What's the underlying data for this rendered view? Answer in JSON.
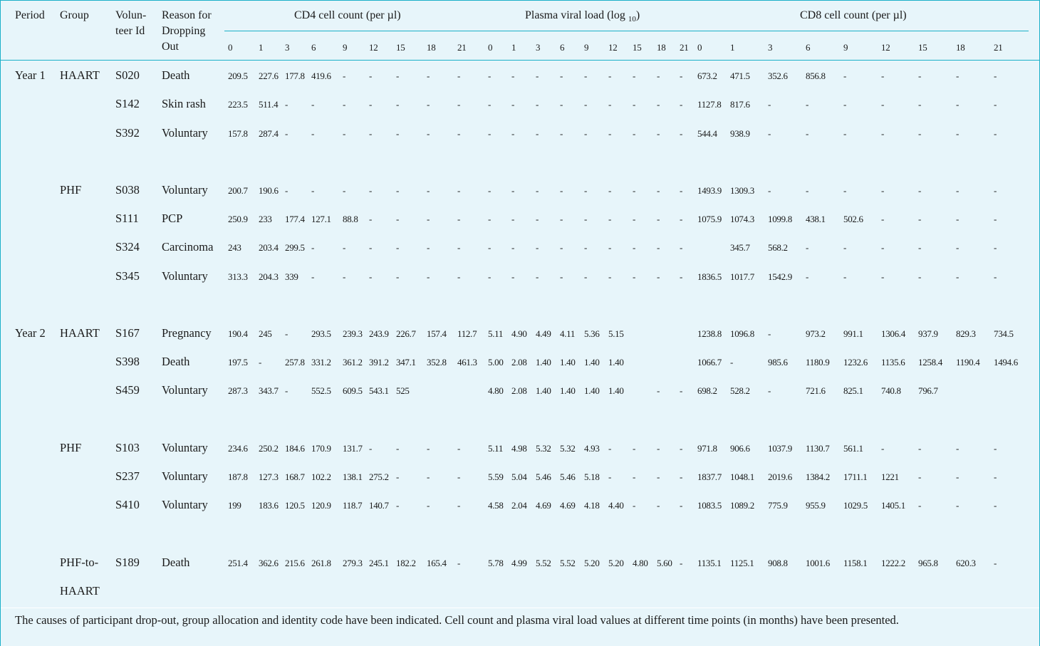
{
  "header": {
    "period": "Period",
    "group": "Group",
    "volunteer_line1": "Volun-",
    "volunteer_line2": "teer Id",
    "reason_line1": "Reason for",
    "reason_line2": "Dropping",
    "reason_line3": "Out",
    "cd4_title": "CD4 cell count (per µl)",
    "viral_title": "Plasma viral load (log",
    "viral_sub": "10",
    "viral_close": ")",
    "cd8_title": "CD8 cell count (per µl)"
  },
  "timepoints": [
    "0",
    "1",
    "3",
    "6",
    "9",
    "12",
    "15",
    "18",
    "21"
  ],
  "rows": [
    {
      "period": "Year 1",
      "group": "HAART",
      "id": "S020",
      "reason": "Death",
      "cd4": [
        "209.5",
        "227.6",
        "177.8",
        "419.6",
        "-",
        "-",
        "-",
        "-",
        "-"
      ],
      "vl": [
        "-",
        "-",
        "-",
        "-",
        "-",
        "-",
        "-",
        "-",
        "-"
      ],
      "cd8": [
        "673.2",
        "471.5",
        "352.6",
        "856.8",
        "-",
        "-",
        "-",
        "-",
        "-"
      ]
    },
    {
      "period": "",
      "group": "",
      "id": "S142",
      "reason": "Skin rash",
      "cd4": [
        "223.5",
        "511.4",
        "-",
        "-",
        "-",
        "-",
        "-",
        "-",
        "-"
      ],
      "vl": [
        "-",
        "-",
        "-",
        "-",
        "-",
        "-",
        "-",
        "-",
        "-"
      ],
      "cd8": [
        "1127.8",
        "817.6",
        "-",
        "-",
        "-",
        "-",
        "-",
        "-",
        "-"
      ]
    },
    {
      "period": "",
      "group": "",
      "id": "S392",
      "reason": "Voluntary",
      "cd4": [
        "157.8",
        "287.4",
        "-",
        "-",
        "-",
        "-",
        "-",
        "-",
        "-"
      ],
      "vl": [
        "-",
        "-",
        "-",
        "-",
        "-",
        "-",
        "-",
        "-",
        "-"
      ],
      "cd8": [
        "544.4",
        "938.9",
        "-",
        "-",
        "-",
        "-",
        "-",
        "-",
        "-"
      ]
    },
    {
      "period": "",
      "group": "PHF",
      "id": "S038",
      "reason": "Voluntary",
      "cd4": [
        "200.7",
        "190.6",
        "-",
        "-",
        "-",
        "-",
        "-",
        "-",
        "-"
      ],
      "vl": [
        "-",
        "-",
        "-",
        "-",
        "-",
        "-",
        "-",
        "-",
        "-"
      ],
      "cd8": [
        "1493.9",
        "1309.3",
        "-",
        "-",
        "-",
        "-",
        "-",
        "-",
        "-"
      ]
    },
    {
      "period": "",
      "group": "",
      "id": "S111",
      "reason": "PCP",
      "cd4": [
        "250.9",
        "233",
        "177.4",
        "127.1",
        "88.8",
        "-",
        "-",
        "-",
        "-"
      ],
      "vl": [
        "-",
        "-",
        "-",
        "-",
        "-",
        "-",
        "-",
        "-",
        "-"
      ],
      "cd8": [
        "1075.9",
        "1074.3",
        "1099.8",
        "438.1",
        "502.6",
        "-",
        "-",
        "-",
        "-"
      ]
    },
    {
      "period": "",
      "group": "",
      "id": "S324",
      "reason": "Carcinoma",
      "cd4": [
        "243",
        "203.4",
        "299.5",
        "-",
        "-",
        "-",
        "-",
        "-",
        "-"
      ],
      "vl": [
        "-",
        "-",
        "-",
        "-",
        "-",
        "-",
        "-",
        "-",
        "-"
      ],
      "cd8": [
        "",
        "345.7",
        "568.2",
        "-",
        "-",
        "-",
        "-",
        "-",
        "-"
      ]
    },
    {
      "period": "",
      "group": "",
      "id": "S345",
      "reason": "Voluntary",
      "cd4": [
        "313.3",
        "204.3",
        "339",
        "-",
        "-",
        "-",
        "-",
        "-",
        "-"
      ],
      "vl": [
        "-",
        "-",
        "-",
        "-",
        "-",
        "-",
        "-",
        "-",
        "-"
      ],
      "cd8": [
        "1836.5",
        "1017.7",
        "1542.9",
        "-",
        "-",
        "-",
        "-",
        "-",
        "-"
      ]
    },
    {
      "period": "Year 2",
      "group": "HAART",
      "id": "S167",
      "reason": "Pregnancy",
      "cd4": [
        "190.4",
        "245",
        "-",
        "293.5",
        "239.3",
        "243.9",
        "226.7",
        "157.4",
        "112.7"
      ],
      "vl": [
        "5.11",
        "4.90",
        "4.49",
        "4.11",
        "5.36",
        "5.15",
        "",
        "",
        ""
      ],
      "cd8": [
        "1238.8",
        "1096.8",
        "-",
        "973.2",
        "991.1",
        "1306.4",
        "937.9",
        "829.3",
        "734.5"
      ]
    },
    {
      "period": "",
      "group": "",
      "id": "S398",
      "reason": "Death",
      "cd4": [
        "197.5",
        "-",
        "257.8",
        "331.2",
        "361.2",
        "391.2",
        "347.1",
        "352.8",
        "461.3"
      ],
      "vl": [
        "5.00",
        "2.08",
        "1.40",
        "1.40",
        "1.40",
        "1.40",
        "",
        "",
        ""
      ],
      "cd8": [
        "1066.7",
        "-",
        "985.6",
        "1180.9",
        "1232.6",
        "1135.6",
        "1258.4",
        "1190.4",
        "1494.6"
      ]
    },
    {
      "period": "",
      "group": "",
      "id": "S459",
      "reason": "Voluntary",
      "cd4": [
        "287.3",
        "343.7",
        "-",
        "552.5",
        "609.5",
        "543.1",
        "525",
        "",
        ""
      ],
      "vl": [
        "4.80",
        "2.08",
        "1.40",
        "1.40",
        "1.40",
        "1.40",
        "",
        "-",
        "-"
      ],
      "cd8": [
        "698.2",
        "528.2",
        "-",
        "721.6",
        "825.1",
        "740.8",
        "796.7",
        "",
        ""
      ]
    },
    {
      "period": "",
      "group": "PHF",
      "id": "S103",
      "reason": "Voluntary",
      "cd4": [
        "234.6",
        "250.2",
        "184.6",
        "170.9",
        "131.7",
        "-",
        "-",
        "-",
        "-"
      ],
      "vl": [
        "5.11",
        "4.98",
        "5.32",
        "5.32",
        "4.93",
        "-",
        "-",
        "-",
        "-"
      ],
      "cd8": [
        "971.8",
        "906.6",
        "1037.9",
        "1130.7",
        "561.1",
        "-",
        "-",
        "-",
        "-"
      ]
    },
    {
      "period": "",
      "group": "",
      "id": "S237",
      "reason": "Voluntary",
      "cd4": [
        "187.8",
        "127.3",
        "168.7",
        "102.2",
        "138.1",
        "275.2",
        "-",
        "-",
        "-"
      ],
      "vl": [
        "5.59",
        "5.04",
        "5.46",
        "5.46",
        "5.18",
        "-",
        "-",
        "-",
        "-"
      ],
      "cd8": [
        "1837.7",
        "1048.1",
        "2019.6",
        "1384.2",
        "1711.1",
        "1221",
        "-",
        "-",
        "-"
      ]
    },
    {
      "period": "",
      "group": "",
      "id": "S410",
      "reason": "Voluntary",
      "cd4": [
        "199",
        "183.6",
        "120.5",
        "120.9",
        "118.7",
        "140.7",
        "-",
        "-",
        "-"
      ],
      "vl": [
        "4.58",
        "2.04",
        "4.69",
        "4.69",
        "4.18",
        "4.40",
        "-",
        "-",
        "-"
      ],
      "cd8": [
        "1083.5",
        "1089.2",
        "775.9",
        "955.9",
        "1029.5",
        "1405.1",
        "-",
        "-",
        "-"
      ]
    },
    {
      "period": "",
      "group": "PHF-to-",
      "id": "S189",
      "reason": "Death",
      "cd4": [
        "251.4",
        "362.6",
        "215.6",
        "261.8",
        "279.3",
        "245.1",
        "182.2",
        "165.4",
        "-"
      ],
      "vl": [
        "5.78",
        "4.99",
        "5.52",
        "5.52",
        "5.20",
        "5.20",
        "4.80",
        "5.60",
        "-"
      ],
      "cd8": [
        "1135.1",
        "1125.1",
        "908.8",
        "1001.6",
        "1158.1",
        "1222.2",
        "965.8",
        "620.3",
        "-"
      ]
    }
  ],
  "group_continuation": "HAART",
  "caption": "The causes of participant drop-out, group allocation and identity code have been indicated. Cell count and plasma viral load values at different time points (in months) have been presented."
}
